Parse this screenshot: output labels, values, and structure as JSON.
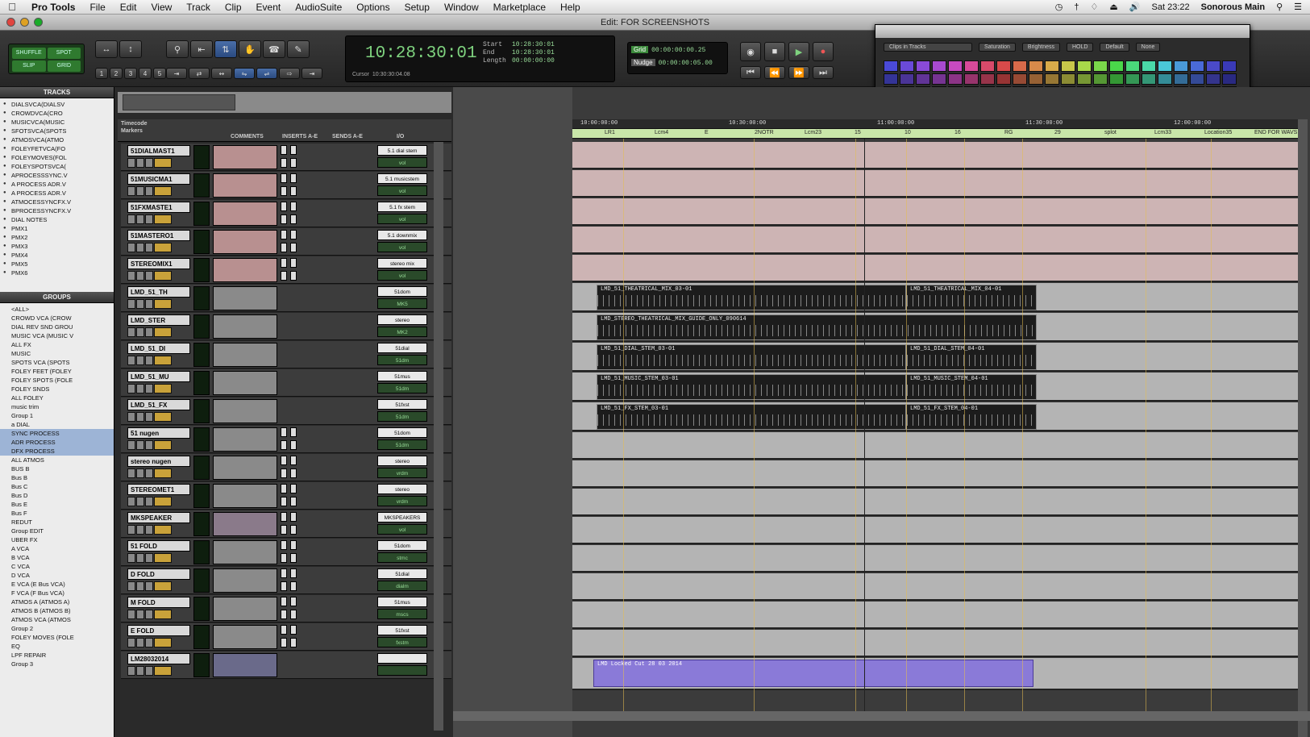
{
  "menubar": {
    "app": "Pro Tools",
    "items": [
      "File",
      "Edit",
      "View",
      "Track",
      "Clip",
      "Event",
      "AudioSuite",
      "Options",
      "Setup",
      "Window",
      "Marketplace",
      "Help"
    ],
    "clock": "Sat 23:22",
    "user": "Sonorous Main"
  },
  "window": {
    "title": "Edit: FOR SCREENSHOTS"
  },
  "toolbar": {
    "modes": [
      "SHUFFLE",
      "SPOT",
      "SLIP",
      "GRID"
    ],
    "counter_main": "10:28:30:01",
    "sel_start_label": "Start",
    "sel_start": "10:28:30:01",
    "sel_end_label": "End",
    "sel_end": "10:28:30:01",
    "sel_len_label": "Length",
    "sel_len": "00:00:00:00",
    "cursor_label": "Cursor",
    "cursor_value": "10:30:30:04.08",
    "grid_label": "Grid",
    "grid_value": "00:00:00:00.25",
    "nudge_label": "Nudge",
    "nudge_value": "00:00:00:05.00"
  },
  "palette": {
    "mode": "Clips in Tracks",
    "saturation": "Saturation",
    "brightness": "Brightness",
    "hold": "HOLD",
    "default": "Default",
    "none": "None",
    "colors": [
      "#4a4ad8",
      "#6a4ad8",
      "#8a4ad8",
      "#a84ad0",
      "#c84ac0",
      "#d84a9a",
      "#d84a6a",
      "#d84a4a",
      "#d86a4a",
      "#d88a4a",
      "#d8aa4a",
      "#c8c84a",
      "#a8d84a",
      "#7ad84a",
      "#4ad84a",
      "#4ad87a",
      "#4ad8a8",
      "#4ac8d8",
      "#4a9ad8",
      "#4a6ad8",
      "#4a4ac8",
      "#3a3ab8"
    ]
  },
  "panels": {
    "tracks": "TRACKS",
    "groups": "GROUPS",
    "timecode": "Timecode",
    "markers": "Markers"
  },
  "tracks": [
    "DIALSVCA(DIALSV",
    "CROWDVCA(CRO",
    "MUSICVCA(MUSIC",
    "SFOTSVCA(SPOTS",
    "ATMOSVCA(ATMO",
    "FOLEYFETVCA(FO",
    "FOLEYMOVES(FOL",
    "FOLEYSPOTSVCA(",
    "APROCESSSYNC.V",
    "A PROCESS ADR.V",
    "A PROCESS ADR.V",
    "ATMOCESSYNCFX.V",
    "BPROCESSYNCFX.V",
    "DIAL NOTES",
    "PMX1",
    "PMX2",
    "PMX3",
    "PMX4",
    "PMX5",
    "PMX6"
  ],
  "groups": [
    {
      "t": "<ALL>"
    },
    {
      "t": "CROWD VCA (CROW"
    },
    {
      "t": "DIAL REV SND GROU"
    },
    {
      "t": "MUSIC VCA (MUSIC V"
    },
    {
      "t": "ALL FX"
    },
    {
      "t": "MUSIC"
    },
    {
      "t": "SPOTS VCA (SPOTS"
    },
    {
      "t": "FOLEY FEET (FOLEY"
    },
    {
      "t": "FOLEY SPOTS (FOLE"
    },
    {
      "t": "FOLEY SNDS"
    },
    {
      "t": "ALL FOLEY"
    },
    {
      "t": "music trim"
    },
    {
      "t": "Group 1"
    },
    {
      "t": "a DIAL"
    },
    {
      "t": "SYNC PROCESS",
      "hl": true
    },
    {
      "t": "ADR PROCESS",
      "hl": true
    },
    {
      "t": "DFX PROCESS",
      "hl": true
    },
    {
      "t": "ALL ATMOS"
    },
    {
      "t": "BUS B"
    },
    {
      "t": "Bus B"
    },
    {
      "t": "Bus C"
    },
    {
      "t": "Bus D"
    },
    {
      "t": "Bus E"
    },
    {
      "t": "Bus F"
    },
    {
      "t": "REDUT"
    },
    {
      "t": "Group EDIT"
    },
    {
      "t": "UBER FX"
    },
    {
      "t": "A VCA"
    },
    {
      "t": "B VCA"
    },
    {
      "t": "C VCA"
    },
    {
      "t": "D VCA"
    },
    {
      "t": "E VCA (E Bus VCA)"
    },
    {
      "t": "F VCA (F Bus VCA)"
    },
    {
      "t": "ATMOS A (ATMOS A)"
    },
    {
      "t": "ATMOS B (ATMOS B)"
    },
    {
      "t": "ATMOS VCA (ATMOS"
    },
    {
      "t": "Group 2"
    },
    {
      "t": "FOLEY MOVES (FOLE"
    },
    {
      "t": "EQ"
    },
    {
      "t": "LPF REPAIR"
    },
    {
      "t": "Group 3"
    }
  ],
  "columns": {
    "comments": "COMMENTS",
    "inserts": "INSERTS A-E",
    "sends": "SENDS A-E",
    "io": "I/O"
  },
  "mixrows": [
    {
      "name": "51DIALMAST1",
      "io1": "5.1 dial stem",
      "io2": "vol",
      "c": "#b89090"
    },
    {
      "name": "51MUSICMA1",
      "io1": "5.1 musicstem",
      "io2": "vol",
      "c": "#b89090"
    },
    {
      "name": "51FXMASTE1",
      "io1": "5.1 fx stem",
      "io2": "vol",
      "c": "#b89090"
    },
    {
      "name": "51MASTERO1",
      "io1": "5.1 downmix",
      "io2": "vol",
      "c": "#b89090"
    },
    {
      "name": "STEREOMIX1",
      "io1": "stereo mix",
      "io2": "vol",
      "c": "#b89090"
    },
    {
      "name": "LMD_51_TH",
      "io1": "51dom",
      "io2": "MK5",
      "c": "#8a8a8a"
    },
    {
      "name": "LMD_STER",
      "io1": "stereo",
      "io2": "MK2",
      "c": "#8a8a8a"
    },
    {
      "name": "LMD_51_DI",
      "io1": "51dial",
      "io2": "51dm",
      "c": "#8a8a8a"
    },
    {
      "name": "LMD_51_MU",
      "io1": "51mus",
      "io2": "51dm",
      "c": "#8a8a8a"
    },
    {
      "name": "LMD_51_FX",
      "io1": "51fxst",
      "io2": "51dm",
      "c": "#8a8a8a"
    },
    {
      "name": "51 nugen",
      "io1": "51dom",
      "io2": "51dm",
      "c": "#8a8a8a"
    },
    {
      "name": "stereo nugen",
      "io1": "stereo",
      "io2": "vrdm",
      "c": "#8a8a8a"
    },
    {
      "name": "STEREOMET1",
      "io1": "stereo",
      "io2": "vrdm",
      "c": "#8a8a8a"
    },
    {
      "name": "MKSPEAKER",
      "io1": "MKSPEAKERS",
      "io2": "vol",
      "c": "#8a7a8a"
    },
    {
      "name": "51 FOLD",
      "io1": "51dom",
      "io2": "stmc",
      "c": "#8a8a8a"
    },
    {
      "name": "D FOLD",
      "io1": "51dial",
      "io2": "dialm",
      "c": "#8a8a8a"
    },
    {
      "name": "M FOLD",
      "io1": "51mus",
      "io2": "mscs",
      "c": "#8a8a8a"
    },
    {
      "name": "E FOLD",
      "io1": "51fxst",
      "io2": "fxstm",
      "c": "#8a8a8a"
    },
    {
      "name": "LM28032014",
      "io1": "",
      "io2": "",
      "c": "#6a6a8a"
    }
  ],
  "ruler": [
    "10:00:00:00",
    "10:30:00:00",
    "11:00:00:00",
    "11:30:00:00",
    "12:00:00:00"
  ],
  "markers": [
    "LR1",
    "Lcm4",
    "E",
    "2NOTR",
    "Lcm23",
    "15",
    "10",
    "16",
    "RG",
    "29",
    "splot",
    "Lcm33",
    "Location35",
    "END FOR WAVS"
  ],
  "clips": [
    {
      "name": "LMD_51_THEATRICAL_MIX_03-01",
      "name2": "LMD_51_THEATRICAL_MIX_04-01"
    },
    {
      "name": "LMD_STEREO_THEATRICAL_MIX_GUIDE_ONLY_090614",
      "name2": ""
    },
    {
      "name": "LMD_51_DIAL_STEM_03-01",
      "name2": "LMD_51_DIAL_STEM_04-01"
    },
    {
      "name": "LMD_51_MUSIC_STEM_03-01",
      "name2": "LMD_51_MUSIC_STEM_04-01"
    },
    {
      "name": "LMD_51_FX_STEM_03-01",
      "name2": "LMD_51_FX_STEM_04-01"
    }
  ],
  "locked_clip": "LMD Locked Cut 28 03 2014"
}
